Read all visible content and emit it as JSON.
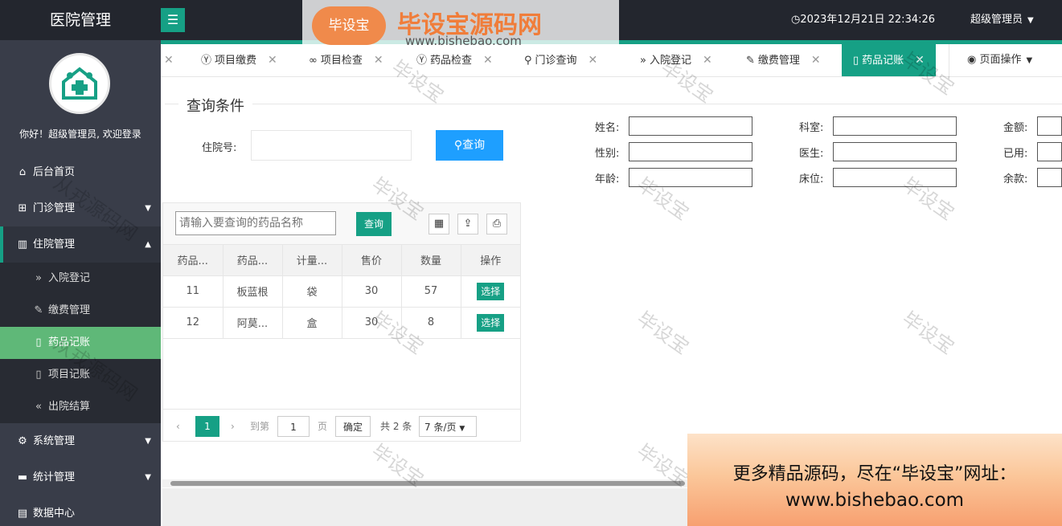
{
  "app": {
    "title": "医院管理",
    "menu_icon": "hamburger-icon"
  },
  "header": {
    "datetime": "2023年12月21日 22:34:26",
    "user": "超级管理员"
  },
  "sidebar": {
    "welcome": "你好！超级管理员, 欢迎登录",
    "items": [
      {
        "label": "后台首页",
        "icon": "home-icon"
      },
      {
        "label": "门诊管理",
        "icon": "grid-plus-icon"
      },
      {
        "label": "住院管理",
        "icon": "bed-icon"
      },
      {
        "label": "系统管理",
        "icon": "gear-icon"
      },
      {
        "label": "统计管理",
        "icon": "chart-icon"
      },
      {
        "label": "数据中心",
        "icon": "database-icon"
      }
    ],
    "sub_items": [
      {
        "label": "入院登记",
        "icon": "double-chevron-right-icon"
      },
      {
        "label": "缴费管理",
        "icon": "edit-icon"
      },
      {
        "label": "药品记账",
        "icon": "book-icon"
      },
      {
        "label": "项目记账",
        "icon": "book-icon"
      },
      {
        "label": "出院结算",
        "icon": "double-chevron-left-icon"
      }
    ]
  },
  "tabs": [
    {
      "label": "项目缴费",
      "icon": "yen-icon"
    },
    {
      "label": "项目检查",
      "icon": "link-icon"
    },
    {
      "label": "药品检查",
      "icon": "yen-icon"
    },
    {
      "label": "门诊查询",
      "icon": "search-icon"
    },
    {
      "label": "入院登记",
      "icon": "double-chevron-right-icon"
    },
    {
      "label": "缴费管理",
      "icon": "edit-icon"
    },
    {
      "label": "药品记账",
      "icon": "book-icon"
    }
  ],
  "page_ops": "页面操作",
  "query": {
    "title": "查询条件",
    "inpatient_label": "住院号:",
    "query_button": "查询",
    "fields": {
      "name": "姓名:",
      "gender": "性别:",
      "age": "年龄:",
      "dept": "科室:",
      "doctor": "医生:",
      "bed": "床位:",
      "amount": "金额:",
      "used": "已用:",
      "balance": "余款:"
    }
  },
  "drug_table": {
    "search_placeholder": "请输入要查询的药品名称",
    "search_button": "查询",
    "headers": [
      "药品...",
      "药品...",
      "计量...",
      "售价",
      "数量",
      "操作"
    ],
    "rows": [
      [
        "11",
        "板蓝根",
        "袋",
        "30",
        "57",
        "选择"
      ],
      [
        "12",
        "阿莫...",
        "盒",
        "30",
        "8",
        "选择"
      ]
    ],
    "pager": {
      "current": "1",
      "goto": "到第",
      "page_input": "1",
      "page_unit": "页",
      "confirm": "确定",
      "total": "共 2 条",
      "per_page": "7 条/页"
    }
  },
  "watermark": {
    "badge": "毕设宝",
    "brand": "毕设宝源码网",
    "url": "www.bishebao.com",
    "text": "毕设宝",
    "text2": "从戎源码网"
  },
  "promo": {
    "line1": "更多精品源码，尽在“毕设宝”网址：",
    "line2": "www.bishebao.com"
  }
}
